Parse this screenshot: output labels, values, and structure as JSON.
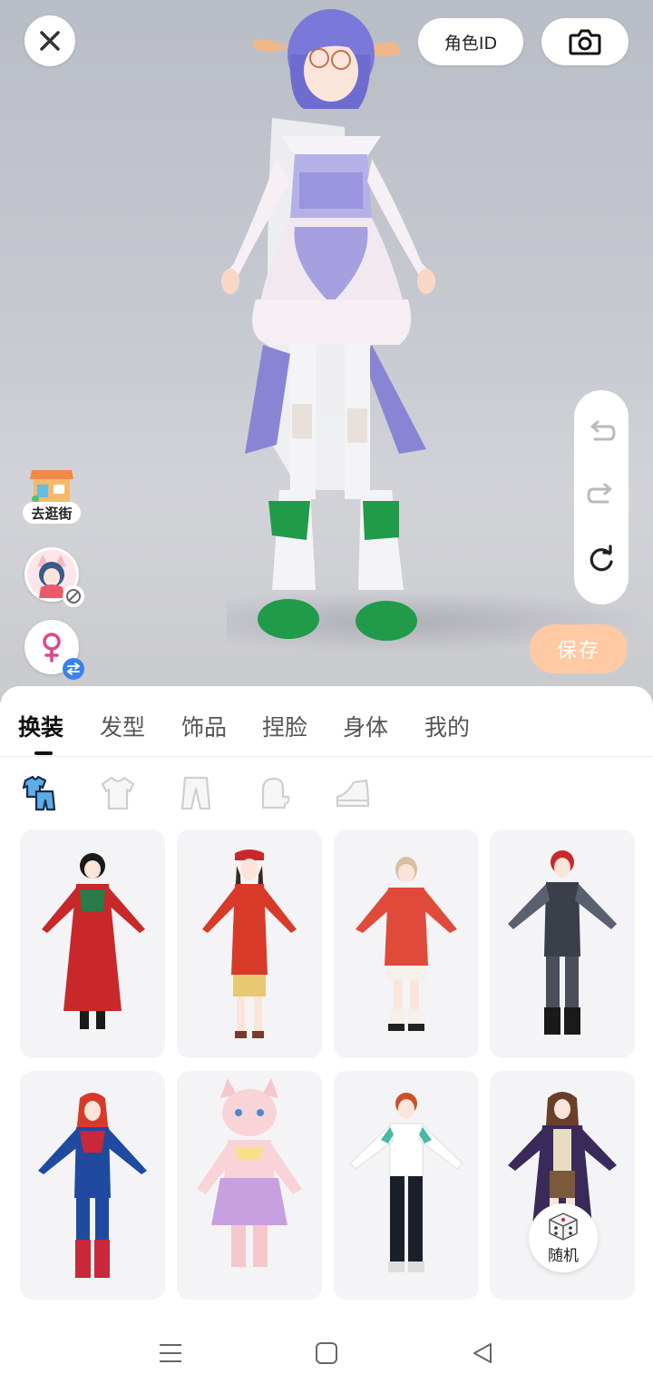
{
  "header": {
    "role_id_label": "角色ID"
  },
  "side": {
    "shop_label": "去逛街"
  },
  "history": {
    "undo": "undo-icon",
    "redo": "redo-icon",
    "reset": "reset-icon"
  },
  "save_label": "保存",
  "tabs": [
    {
      "label": "换装",
      "active": true
    },
    {
      "label": "发型",
      "active": false
    },
    {
      "label": "饰品",
      "active": false
    },
    {
      "label": "捏脸",
      "active": false
    },
    {
      "label": "身体",
      "active": false
    },
    {
      "label": "我的",
      "active": false
    }
  ],
  "subcategories": [
    "outfit-icon",
    "top-icon",
    "pants-icon",
    "gloves-icon",
    "shoes-icon"
  ],
  "outfits": [
    {
      "id": "outfit-1",
      "palette": [
        "#c8282a",
        "#2a7a4a",
        "#1a1a1a"
      ]
    },
    {
      "id": "outfit-2",
      "palette": [
        "#d83a2a",
        "#e8c870",
        "#7a3a2a"
      ]
    },
    {
      "id": "outfit-3",
      "palette": [
        "#e04a3a",
        "#f5f0ea",
        "#d8c0a0"
      ]
    },
    {
      "id": "outfit-4",
      "palette": [
        "#3a3f4a",
        "#5a6070",
        "#c8282a"
      ]
    },
    {
      "id": "outfit-5",
      "palette": [
        "#1f4aa0",
        "#c8283a",
        "#d83a2a"
      ]
    },
    {
      "id": "outfit-6",
      "palette": [
        "#f5c6cc",
        "#c8a0e0",
        "#f8e08a"
      ]
    },
    {
      "id": "outfit-7",
      "palette": [
        "#ffffff",
        "#1a1f2a",
        "#4ab8a8"
      ]
    },
    {
      "id": "outfit-8",
      "palette": [
        "#3a2a5a",
        "#7a5a3a",
        "#e8dcc0"
      ]
    }
  ],
  "random_label": "随机",
  "colors": {
    "save_bg": "#ffc9a3",
    "active_tab": "#111111",
    "card_bg": "#f4f4f6"
  }
}
